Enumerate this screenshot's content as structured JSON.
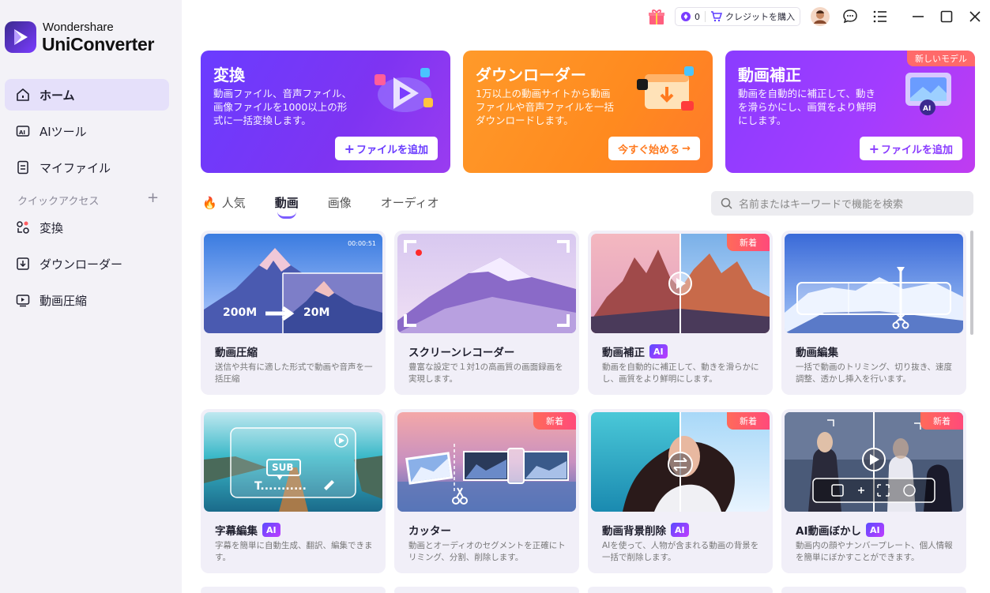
{
  "app": {
    "brand_top": "Wondershare",
    "brand_name": "UniConverter"
  },
  "sidebar": {
    "items": [
      {
        "label": "ホーム"
      },
      {
        "label": "AIツール"
      },
      {
        "label": "マイファイル"
      }
    ],
    "quick_access_label": "クイックアクセス",
    "quick_items": [
      {
        "label": "変換"
      },
      {
        "label": "ダウンローダー"
      },
      {
        "label": "動画圧縮"
      }
    ]
  },
  "topbar": {
    "credits": "0",
    "buy_credits": "クレジットを購入"
  },
  "banners": [
    {
      "title": "変換",
      "desc": "動画ファイル、音声ファイル、画像ファイルを1000以上の形式に一括変換します。",
      "button": "ファイルを追加",
      "color": "#7a3cff"
    },
    {
      "title": "ダウンローダー",
      "desc": "1万以上の動画サイトから動画ファイルや音声ファイルを一括ダウンロードします。",
      "button": "今すぐ始める",
      "color": "#ff8a1f"
    },
    {
      "title": "動画補正",
      "desc": "動画を自動的に補正して、動きを滑らかにし、画質をより鮮明にします。",
      "button": "ファイルを追加",
      "badge": "新しいモデル",
      "color": "#a83cff"
    }
  ],
  "tabs": [
    {
      "label": "人気"
    },
    {
      "label": "動画"
    },
    {
      "label": "画像"
    },
    {
      "label": "オーディオ"
    }
  ],
  "search": {
    "placeholder": "名前またはキーワードで機能を検索"
  },
  "cards": [
    {
      "title": "動画圧縮",
      "desc": "送信や共有に適した形式で動画や音声を一括圧縮",
      "ai": false,
      "timestamp": "00:00:51",
      "size_from": "200M",
      "size_to": "20M"
    },
    {
      "title": "スクリーンレコーダー",
      "desc": "豊富な設定で１対1の高画質の画面録画を実現します。",
      "ai": false
    },
    {
      "title": "動画補正",
      "desc": "動画を自動的に補正して、動きを滑らかにし、画質をより鮮明にします。",
      "ai": true,
      "badge": "新着"
    },
    {
      "title": "動画編集",
      "desc": "一括で動画のトリミング、切り抜き、速度調整、透かし挿入を行います。",
      "ai": false
    },
    {
      "title": "字幕編集",
      "desc": "字幕を簡単に自動生成、翻訳、編集できます。",
      "ai": true,
      "sub_label": "SUB",
      "t_label": "T..........."
    },
    {
      "title": "カッター",
      "desc": "動画とオーディオのセグメントを正確にトリミング、分割、削除します。",
      "ai": false,
      "badge": "新着"
    },
    {
      "title": "動画背景削除",
      "desc": "AIを使って、人物が含まれる動画の背景を一括で削除します。",
      "ai": true,
      "badge": "新着"
    },
    {
      "title": "AI動画ぼかし",
      "desc": "動画内の顔やナンバープレート、個人情報を簡単にぼかすことができます。",
      "ai": true,
      "badge": "新着"
    }
  ],
  "ai_label": "AI"
}
